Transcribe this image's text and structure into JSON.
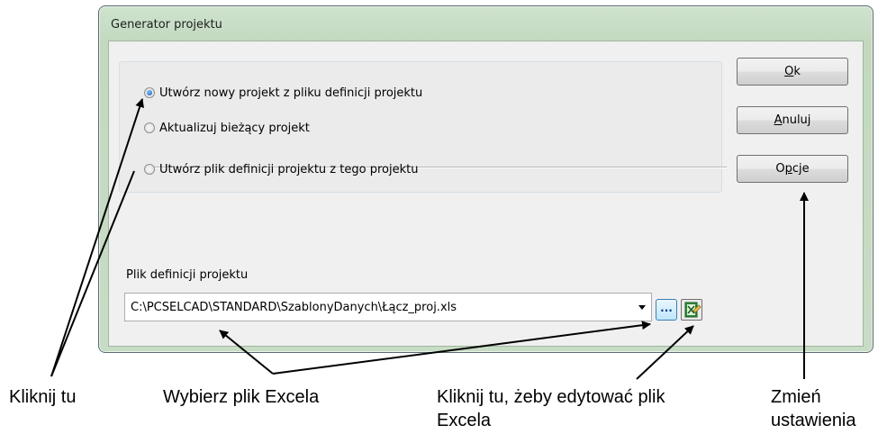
{
  "window": {
    "title": "Generator projektu"
  },
  "options": {
    "create_new": "Utwórz nowy projekt z pliku definicji projektu",
    "update": "Aktualizuj bieżący projekt",
    "create_definition": "Utwórz plik definicji projektu z tego projektu",
    "selected": "create_new"
  },
  "buttons": {
    "ok_mnemonic": "O",
    "ok_rest": "k",
    "cancel_mnemonic": "A",
    "cancel_rest": "nuluj",
    "options_pre": "O",
    "options_mnemonic": "p",
    "options_rest": "cje"
  },
  "definition_file": {
    "label": "Plik definicji projektu",
    "value": "C:\\PCSELCAD\\STANDARD\\SzablonyDanych\\Łącz_proj.xls",
    "browse_label": "..."
  },
  "callouts": {
    "click_here": "Kliknij tu",
    "choose_excel": "Wybierz plik Excela",
    "edit_excel_line1": "Kliknij tu, żeby edytować plik",
    "edit_excel_line2": "Excela",
    "change_settings_line1": "Zmień",
    "change_settings_line2": "ustawienia"
  },
  "colors": {
    "frame": "#c2d9c0",
    "radio_checked": "#1a5fb4",
    "browse_button": "#bee6fd"
  }
}
